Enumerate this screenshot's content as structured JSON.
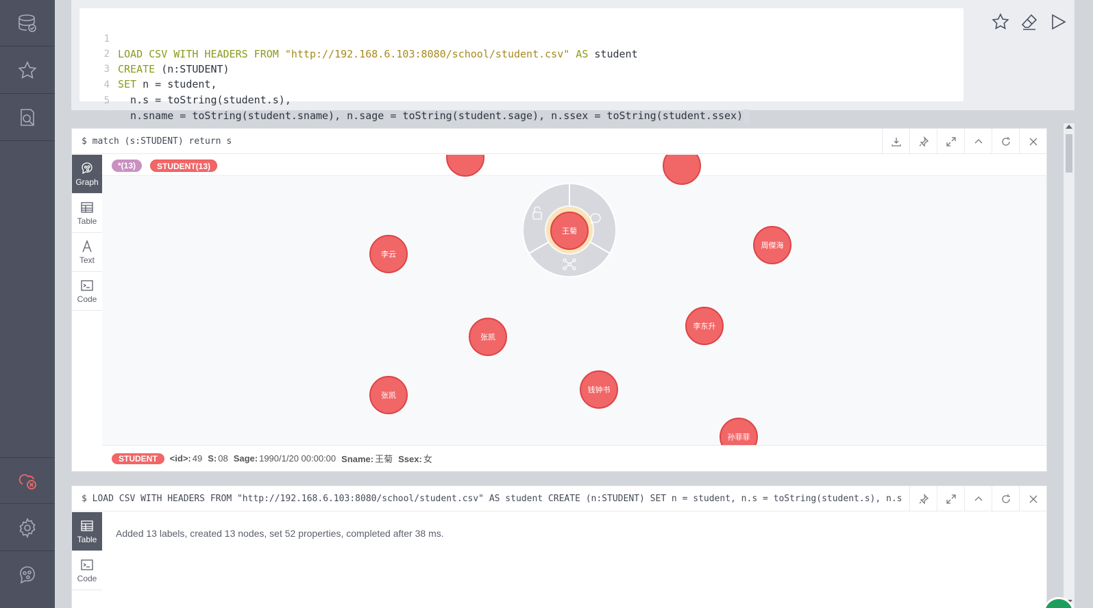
{
  "sidebar": {
    "items": [
      {
        "icon": "database-icon"
      },
      {
        "icon": "star-icon"
      },
      {
        "icon": "document-search-icon"
      },
      {
        "icon": "connection-error-icon"
      },
      {
        "icon": "gear-icon"
      },
      {
        "icon": "neo4j-logo-icon"
      }
    ]
  },
  "editor": {
    "lines": [
      {
        "n": "1",
        "kw1": "LOAD CSV WITH HEADERS FROM ",
        "str": "\"http://192.168.6.103:8080/school/student.csv\"",
        "kw2": " AS",
        "rest": " student"
      },
      {
        "n": "2",
        "kw1": "CREATE",
        "str": "",
        "kw2": "",
        "rest": " (n:STUDENT)"
      },
      {
        "n": "3",
        "kw1": "SET",
        "str": "",
        "kw2": "",
        "rest": " n = student,"
      },
      {
        "n": "4",
        "kw1": "",
        "str": "",
        "kw2": "",
        "rest": "  n.s = toString(student.s),"
      },
      {
        "n": "5",
        "kw1": "",
        "str": "",
        "kw2": "",
        "rest": "  n.sname = toString(student.sname), n.sage = toString(student.sage), n.ssex = toString(student.ssex)"
      }
    ]
  },
  "frame1": {
    "command": "$ match (s:STUDENT) return s",
    "views": [
      "Graph",
      "Table",
      "Text",
      "Code"
    ],
    "legend": {
      "all": "*(13)",
      "student": "STUDENT(13)"
    },
    "nodes": [
      "李云",
      "王菊",
      "周傑海",
      "张凯",
      "李东升",
      "张凯",
      "钱钟书",
      "孙菲菲"
    ],
    "properties": {
      "label": "STUDENT",
      "id_key": "<id>:",
      "id_val": "49",
      "s_key": "S:",
      "s_val": "08",
      "sage_key": "Sage:",
      "sage_val": "1990/1/20 00:00:00",
      "sname_key": "Sname:",
      "sname_val": "王菊",
      "ssex_key": "Ssex:",
      "ssex_val": "女"
    }
  },
  "frame2": {
    "command": "$ LOAD CSV WITH HEADERS FROM \"http://192.168.6.103:8080/school/student.csv\" AS student CREATE (n:STUDENT) SET n = student, n.s = toString(student.s), n.sna…",
    "views": [
      "Table",
      "Code"
    ],
    "message": "Added 13 labels, created 13 nodes, set 52 properties, completed after 38 ms."
  },
  "colors": {
    "node": "#f16667",
    "sidebar": "#4d5160",
    "label_all": "#c990c0"
  }
}
